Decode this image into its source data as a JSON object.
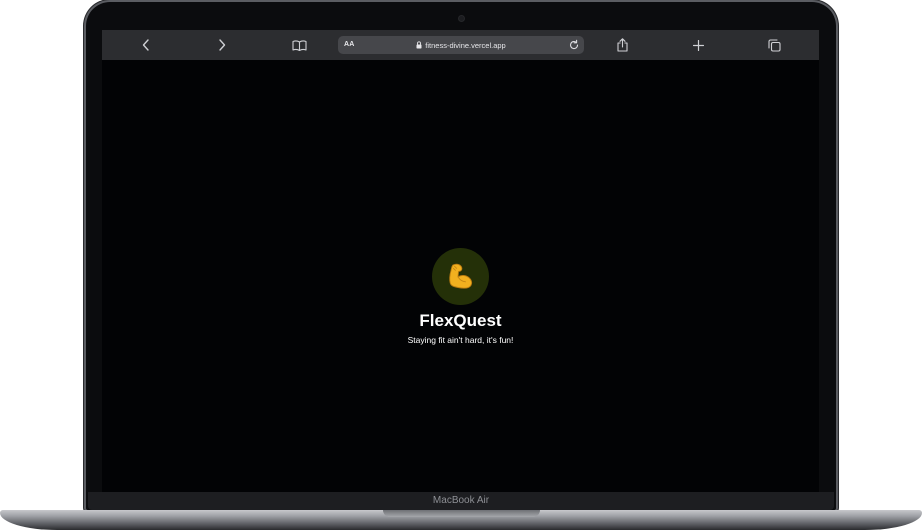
{
  "browser": {
    "url": "fitness-divine.vercel.app",
    "reader_label": "AA",
    "icons": {
      "back": "chevron-left-icon",
      "forward": "chevron-right-icon",
      "bookmarks": "book-icon",
      "lock": "lock-icon",
      "reload": "reload-icon",
      "share": "share-icon",
      "new_tab": "plus-icon",
      "tabs": "tabs-icon"
    }
  },
  "app": {
    "logo_icon": "flexed-biceps-icon",
    "title": "FlexQuest",
    "tagline": "Staying fit ain't hard, it's fun!",
    "accent_color": "#243008",
    "background_color": "#020305"
  },
  "device": {
    "label": "MacBook Air"
  }
}
